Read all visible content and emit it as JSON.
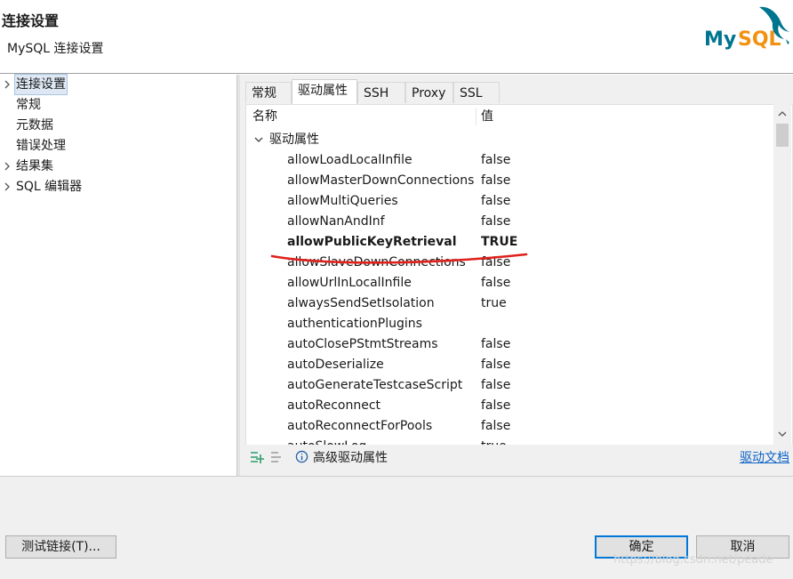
{
  "dialog": {
    "title": "连接设置",
    "subtitle": "MySQL 连接设置",
    "logo_text": "MySQL"
  },
  "nav": {
    "items": [
      {
        "label": "连接设置",
        "expandable": true,
        "selected": true
      },
      {
        "label": "常规",
        "expandable": false
      },
      {
        "label": "元数据",
        "expandable": false
      },
      {
        "label": "错误处理",
        "expandable": false
      },
      {
        "label": "结果集",
        "expandable": true
      },
      {
        "label": "SQL 编辑器",
        "expandable": true
      }
    ]
  },
  "tabs": [
    {
      "label": "常规",
      "active": false
    },
    {
      "label": "驱动属性",
      "active": true
    },
    {
      "label": "SSH",
      "active": false
    },
    {
      "label": "Proxy",
      "active": false
    },
    {
      "label": "SSL",
      "active": false
    }
  ],
  "properties": {
    "col_name": "名称",
    "col_value": "值",
    "group_label": "驱动属性",
    "rows": [
      {
        "name": "allowLoadLocalInfile",
        "value": "false"
      },
      {
        "name": "allowMasterDownConnections",
        "value": "false"
      },
      {
        "name": "allowMultiQueries",
        "value": "false"
      },
      {
        "name": "allowNanAndInf",
        "value": "false"
      },
      {
        "name": "allowPublicKeyRetrieval",
        "value": "TRUE",
        "bold": true
      },
      {
        "name": "allowSlaveDownConnections",
        "value": "false"
      },
      {
        "name": "allowUrlInLocalInfile",
        "value": "false"
      },
      {
        "name": "alwaysSendSetIsolation",
        "value": "true"
      },
      {
        "name": "authenticationPlugins",
        "value": ""
      },
      {
        "name": "autoClosePStmtStreams",
        "value": "false"
      },
      {
        "name": "autoDeserialize",
        "value": "false"
      },
      {
        "name": "autoGenerateTestcaseScript",
        "value": "false"
      },
      {
        "name": "autoReconnect",
        "value": "false"
      },
      {
        "name": "autoReconnectForPools",
        "value": "false"
      },
      {
        "name": "autoSlowLog",
        "value": "true"
      }
    ]
  },
  "footer": {
    "advanced_label": "高级驱动属性",
    "docs_link": "驱动文档"
  },
  "buttons": {
    "test": "测试链接(T)...",
    "ok": "确定",
    "cancel": "取消"
  },
  "watermark": "https://blog.csdn.net/peade",
  "colors": {
    "accent": "#0078d7",
    "annotation": "#e0201b",
    "logo_blue": "#00758f",
    "logo_orange": "#f29111"
  }
}
